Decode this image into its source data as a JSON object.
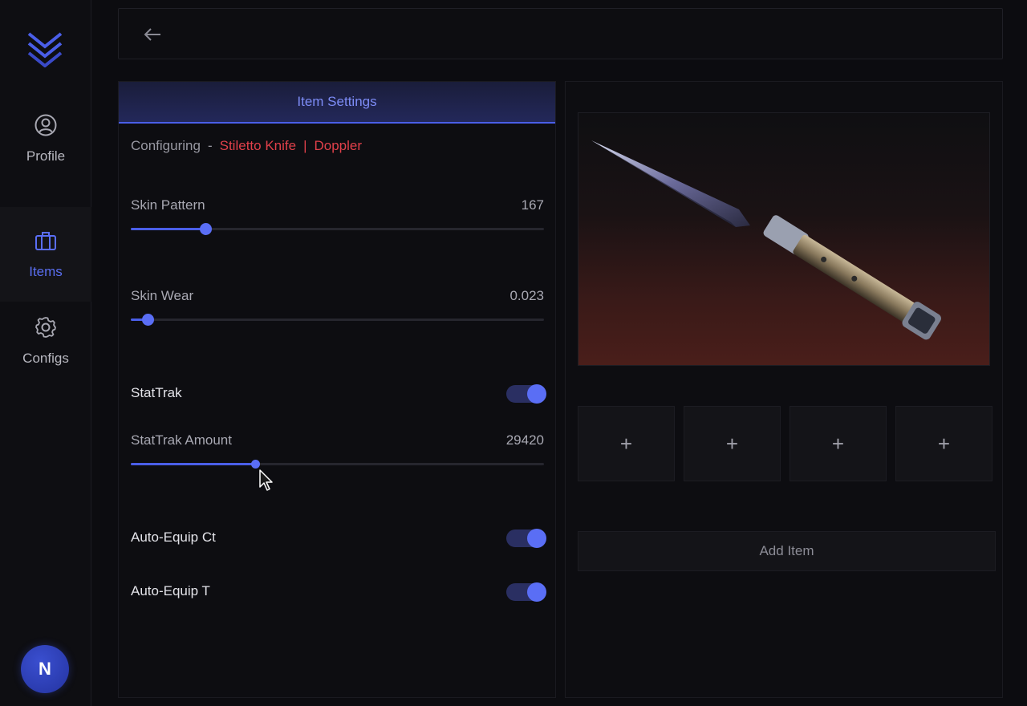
{
  "sidebar": {
    "items": [
      {
        "label": "Profile",
        "icon": "user-circle-icon"
      },
      {
        "label": "Items",
        "icon": "briefcase-icon",
        "active": true
      },
      {
        "label": "Configs",
        "icon": "gear-icon"
      }
    ],
    "avatar_initial": "N"
  },
  "header": {
    "back_icon": "arrow-left-icon"
  },
  "settings": {
    "title": "Item Settings",
    "configuring_label": "Configuring",
    "dash": "-",
    "item_name": "Stiletto Knife",
    "divider": "|",
    "skin_name": "Doppler",
    "skin_pattern": {
      "label": "Skin Pattern",
      "value": "167",
      "fraction": 0.18
    },
    "skin_wear": {
      "label": "Skin Wear",
      "value": "0.023",
      "fraction": 0.04
    },
    "stattrak": {
      "label": "StatTrak",
      "enabled": true
    },
    "stattrak_amount": {
      "label": "StatTrak Amount",
      "value": "29420",
      "fraction": 0.3
    },
    "auto_equip_ct": {
      "label": "Auto-Equip Ct",
      "enabled": true
    },
    "auto_equip_t": {
      "label": "Auto-Equip T",
      "enabled": true
    }
  },
  "preview": {
    "slots": [
      "+",
      "+",
      "+",
      "+"
    ],
    "add_item_label": "Add Item"
  },
  "colors": {
    "accent": "#5a6ef5",
    "item_red": "#e0404a",
    "background": "#0c0c10"
  }
}
